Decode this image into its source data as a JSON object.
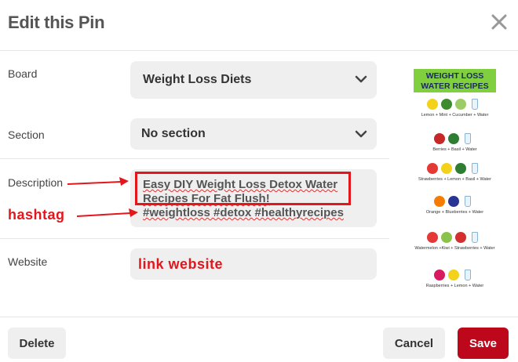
{
  "dialog": {
    "title": "Edit this Pin"
  },
  "fields": {
    "board": {
      "label": "Board",
      "value": "Weight Loss Diets"
    },
    "section": {
      "label": "Section",
      "value": "No section"
    },
    "description": {
      "label": "Description",
      "line1": "Easy DIY Weight Loss Detox Water",
      "line2": "Recipes For Fat Flush!",
      "line3": "#weightloss #detox #healthyrecipes"
    },
    "website": {
      "label": "Website",
      "value": "link website"
    }
  },
  "annotations": {
    "hashtag": "hashtag"
  },
  "pin": {
    "title_line1": "WEIGHT LOSS",
    "title_line2": "WATER RECIPES",
    "rows": [
      {
        "caption": "Lemon + Mint + Cucumber + Water",
        "colors": [
          "#f2d21b",
          "#3d8b2e",
          "#9ccc65"
        ]
      },
      {
        "caption": "Berries + Basil + Water",
        "colors": [
          "#c62828",
          "#2e7d32"
        ]
      },
      {
        "caption": "Strawberries + Lemon + Basil + Water",
        "colors": [
          "#e53935",
          "#f2d21b",
          "#2e7d32"
        ]
      },
      {
        "caption": "Orange + Blueberries + Water",
        "colors": [
          "#f57c00",
          "#283593"
        ]
      },
      {
        "caption": "Watermelon +Kiwi + Strawberries + Water",
        "colors": [
          "#e53935",
          "#8bc34a",
          "#d32f2f"
        ]
      },
      {
        "caption": "Raspberries + Lemon + Water",
        "colors": [
          "#d81b60",
          "#f2d21b"
        ]
      }
    ]
  },
  "buttons": {
    "delete": "Delete",
    "cancel": "Cancel",
    "save": "Save"
  },
  "colors": {
    "save_bg": "#bd081c",
    "annotation_red": "#e3161b",
    "field_bg": "#efefef",
    "pin_title_bg": "#7fcf3e"
  },
  "icons": {
    "close": "close-icon",
    "chevron": "chevron-down-icon"
  }
}
